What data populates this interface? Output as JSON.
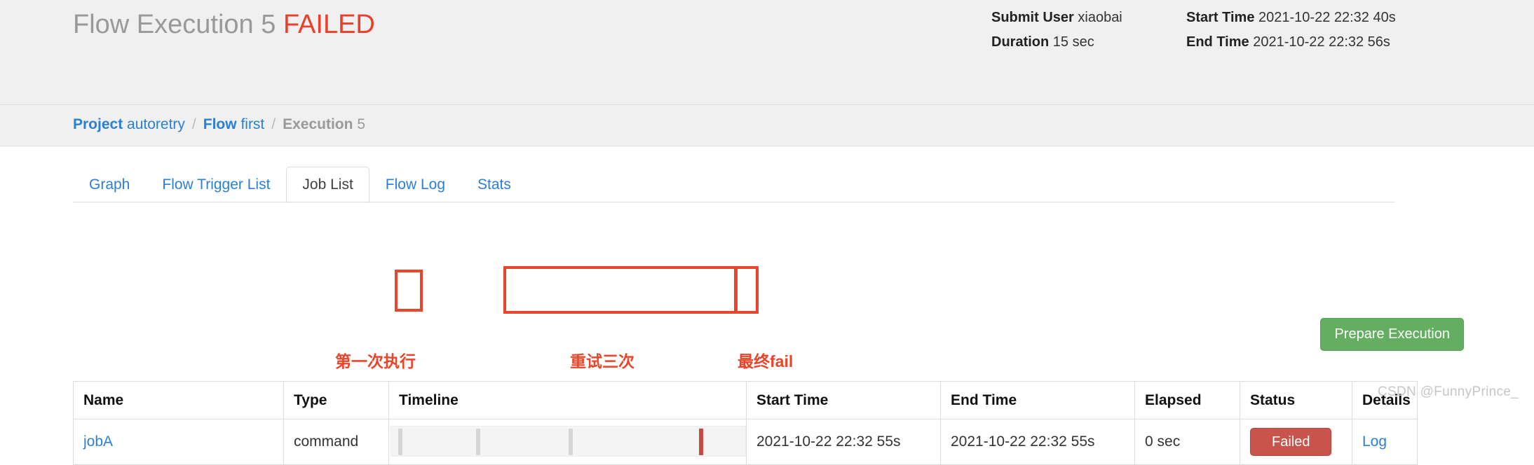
{
  "header": {
    "title_prefix": "Flow Execution",
    "execution_number": "5",
    "status": "FAILED",
    "status_color": "#e8402a",
    "meta_left": [
      {
        "key": "Submit User",
        "value": "xiaobai"
      },
      {
        "key": "Duration",
        "value": "15 sec"
      }
    ],
    "meta_right": [
      {
        "key": "Start Time",
        "value": "2021-10-22 22:32 40s"
      },
      {
        "key": "End Time",
        "value": "2021-10-22 22:32 56s"
      }
    ]
  },
  "breadcrumb": {
    "project_label": "Project",
    "project_value": "autoretry",
    "flow_label": "Flow",
    "flow_value": "first",
    "execution_label": "Execution",
    "execution_value": "5",
    "separator": "/"
  },
  "tabs": [
    {
      "label": "Graph",
      "active": false
    },
    {
      "label": "Flow Trigger List",
      "active": false
    },
    {
      "label": "Job List",
      "active": true
    },
    {
      "label": "Flow Log",
      "active": false
    },
    {
      "label": "Stats",
      "active": false
    }
  ],
  "actions": {
    "prepare_execution": "Prepare Execution",
    "prepare_execution_color": "#64ae62"
  },
  "table": {
    "columns": [
      "Name",
      "Type",
      "Timeline",
      "Start Time",
      "End Time",
      "Elapsed",
      "Status",
      "Details"
    ],
    "rows": [
      {
        "name": "jobA",
        "type": "command",
        "start_time": "2021-10-22 22:32 55s",
        "end_time": "2021-10-22 22:32 55s",
        "elapsed": "0 sec",
        "status": "Failed",
        "status_color": "#c9544b",
        "details": "Log"
      }
    ]
  },
  "timeline": {
    "ticks": [
      {
        "position_pct": 2,
        "kind": "attempt"
      },
      {
        "position_pct": 24,
        "kind": "attempt"
      },
      {
        "position_pct": 50,
        "kind": "attempt"
      },
      {
        "position_pct": 87,
        "kind": "fail"
      }
    ]
  },
  "annotations": {
    "color": "#e8452a",
    "labels": [
      {
        "text": "第一次执行"
      },
      {
        "text": "重试三次"
      },
      {
        "text": "最终fail"
      }
    ]
  },
  "watermark": "CSDN @FunnyPrince_"
}
